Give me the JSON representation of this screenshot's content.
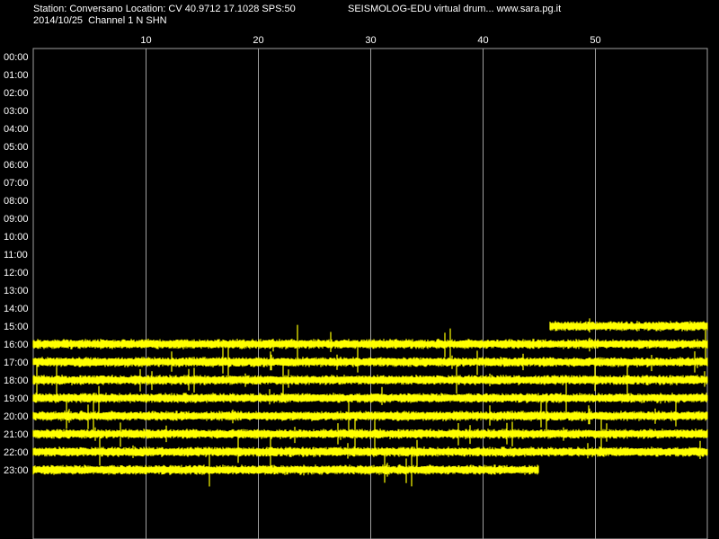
{
  "header": {
    "station_line": "Station: Conversano Location: CV 40.9712 17.1028 SPS:50",
    "date_line": "2014/10/25  Channel 1 N SHN",
    "brand_line": "SEISMOLOG-EDU virtual drum... www.sara.pg.it"
  },
  "colors": {
    "background": "#000000",
    "trace": "#ffff00",
    "grid": "#a0a0a0",
    "text": "#ffffff"
  },
  "chart_data": {
    "type": "line",
    "title": "",
    "xlabel": "",
    "ylabel": "",
    "x_ticks": [
      10,
      20,
      30,
      40,
      50
    ],
    "xlim": [
      0,
      60
    ],
    "row_labels": [
      "00:00",
      "01:00",
      "02:00",
      "03:00",
      "04:00",
      "05:00",
      "06:00",
      "07:00",
      "08:00",
      "09:00",
      "10:00",
      "11:00",
      "12:00",
      "13:00",
      "14:00",
      "15:00",
      "16:00",
      "17:00",
      "18:00",
      "19:00",
      "20:00",
      "21:00",
      "22:00",
      "23:00"
    ],
    "grid": true,
    "record_start": {
      "hour": 15,
      "minute": 46
    },
    "record_end": {
      "hour": 23,
      "minute": 45
    }
  }
}
